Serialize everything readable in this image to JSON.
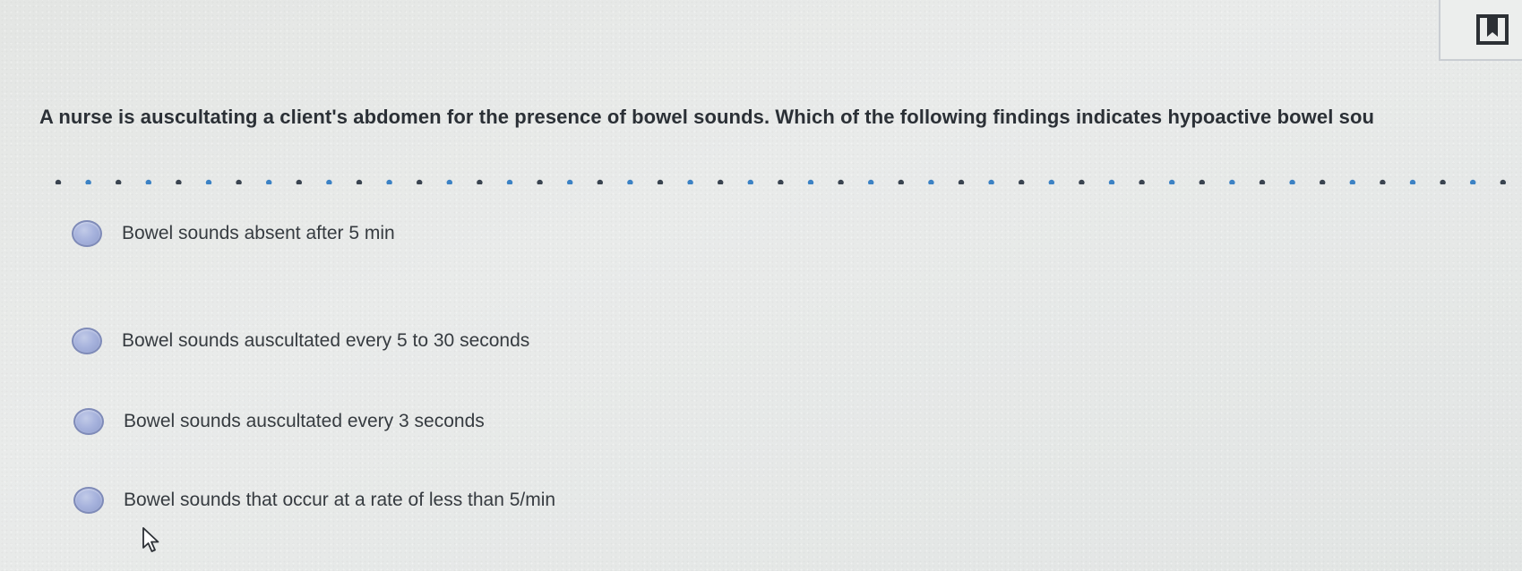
{
  "question": {
    "text": "A nurse is auscultating a client's abdomen for the presence of bowel sounds. Which of the following findings indicates hypoactive bowel sou"
  },
  "options": [
    {
      "label": "Bowel sounds absent after 5 min",
      "selected": false
    },
    {
      "label": "Bowel sounds auscultated every 5 to 30 seconds",
      "selected": false
    },
    {
      "label": "Bowel sounds auscultated every 3 seconds",
      "selected": false
    },
    {
      "label": "Bowel sounds that occur at a rate of less than 5/min",
      "selected": false
    }
  ],
  "toolbar": {
    "bookmark_icon": "bookmark-icon"
  },
  "colors": {
    "dot_dark": "#3a4450",
    "dot_blue": "#3c82c4",
    "radio_fill": "#a7b3dd"
  }
}
